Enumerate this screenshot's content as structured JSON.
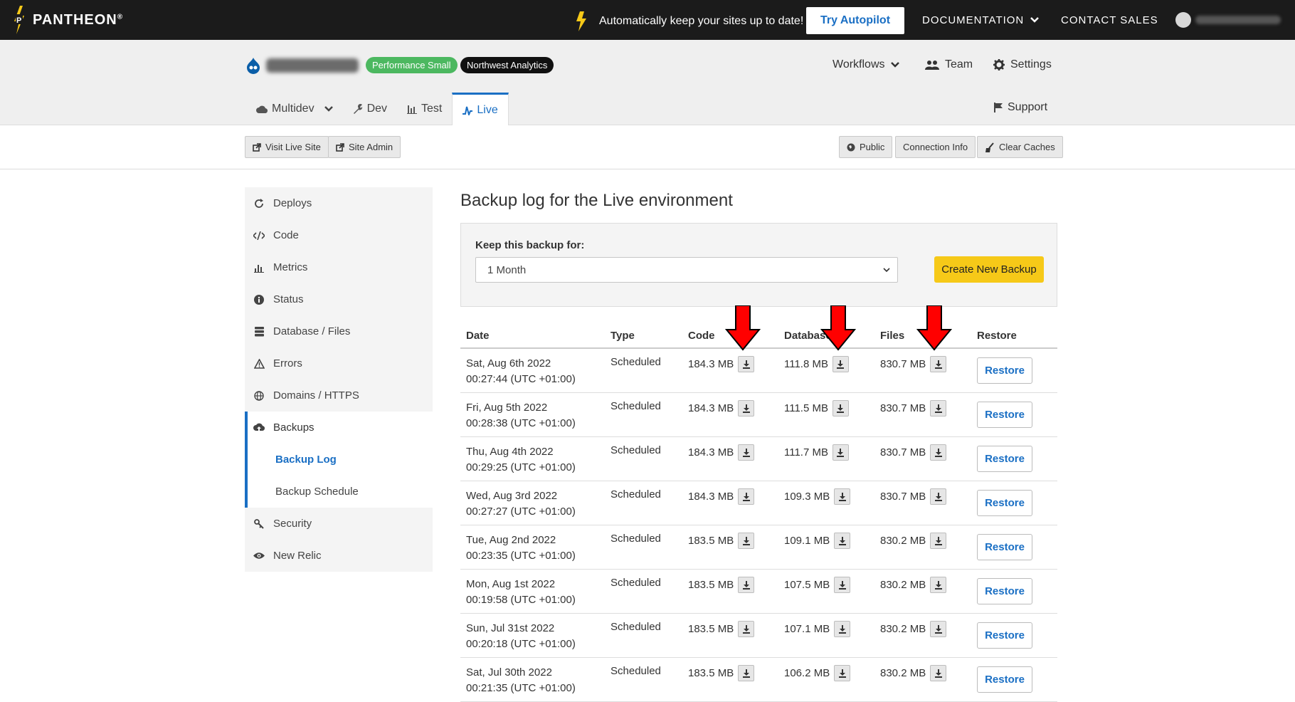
{
  "topbar": {
    "logo_text": "PANTHEON",
    "logo_reg": "®",
    "promo_text": "Automatically keep your sites up to date!",
    "try_button": "Try Autopilot",
    "documentation": "DOCUMENTATION",
    "contact_sales": "CONTACT SALES"
  },
  "site": {
    "badge_plan": "Performance Small",
    "badge_org": "Northwest Analytics",
    "workflows": "Workflows",
    "team": "Team",
    "settings": "Settings",
    "support": "Support"
  },
  "tabs": [
    {
      "label": "Multidev"
    },
    {
      "label": "Dev"
    },
    {
      "label": "Test"
    },
    {
      "label": "Live"
    }
  ],
  "toolbar": {
    "visit_live_site": "Visit Live Site",
    "site_admin": "Site Admin",
    "public": "Public",
    "connection_info": "Connection Info",
    "clear_caches": "Clear Caches"
  },
  "sidebar": {
    "items": [
      {
        "label": "Deploys",
        "icon": "refresh-icon"
      },
      {
        "label": "Code",
        "icon": "code-icon"
      },
      {
        "label": "Metrics",
        "icon": "bar-chart-icon"
      },
      {
        "label": "Status",
        "icon": "info-icon"
      },
      {
        "label": "Database / Files",
        "icon": "database-icon"
      },
      {
        "label": "Errors",
        "icon": "warning-icon"
      },
      {
        "label": "Domains / HTTPS",
        "icon": "globe-icon"
      },
      {
        "label": "Backups",
        "icon": "cloud-upload-icon"
      },
      {
        "label": "Backup Log"
      },
      {
        "label": "Backup Schedule"
      },
      {
        "label": "Security",
        "icon": "key-icon"
      },
      {
        "label": "New Relic",
        "icon": "eye-icon"
      }
    ]
  },
  "main": {
    "title": "Backup log for the Live environment",
    "keep_label": "Keep this backup for:",
    "keep_value": "1 Month",
    "create_button": "Create New Backup"
  },
  "table": {
    "headers": [
      "Date",
      "Type",
      "Code",
      "Database",
      "Files",
      "Restore"
    ],
    "rows": [
      {
        "date": "Sat, Aug 6th 2022",
        "time": "00:27:44 (UTC +01:00)",
        "type": "Scheduled",
        "code": "184.3 MB",
        "db": "111.8 MB",
        "files": "830.7 MB",
        "restore": "Restore"
      },
      {
        "date": "Fri, Aug 5th 2022",
        "time": "00:28:38 (UTC +01:00)",
        "type": "Scheduled",
        "code": "184.3 MB",
        "db": "111.5 MB",
        "files": "830.7 MB",
        "restore": "Restore"
      },
      {
        "date": "Thu, Aug 4th 2022",
        "time": "00:29:25 (UTC +01:00)",
        "type": "Scheduled",
        "code": "184.3 MB",
        "db": "111.7 MB",
        "files": "830.7 MB",
        "restore": "Restore"
      },
      {
        "date": "Wed, Aug 3rd 2022",
        "time": "00:27:27 (UTC +01:00)",
        "type": "Scheduled",
        "code": "184.3 MB",
        "db": "109.3 MB",
        "files": "830.7 MB",
        "restore": "Restore"
      },
      {
        "date": "Tue, Aug 2nd 2022",
        "time": "00:23:35 (UTC +01:00)",
        "type": "Scheduled",
        "code": "183.5 MB",
        "db": "109.1 MB",
        "files": "830.2 MB",
        "restore": "Restore"
      },
      {
        "date": "Mon, Aug 1st 2022",
        "time": "00:19:58 (UTC +01:00)",
        "type": "Scheduled",
        "code": "183.5 MB",
        "db": "107.5 MB",
        "files": "830.2 MB",
        "restore": "Restore"
      },
      {
        "date": "Sun, Jul 31st 2022",
        "time": "00:20:18 (UTC +01:00)",
        "type": "Scheduled",
        "code": "183.5 MB",
        "db": "107.1 MB",
        "files": "830.2 MB",
        "restore": "Restore"
      },
      {
        "date": "Sat, Jul 30th 2022",
        "time": "00:21:35 (UTC +01:00)",
        "type": "Scheduled",
        "code": "183.5 MB",
        "db": "106.2 MB",
        "files": "830.2 MB",
        "restore": "Restore"
      }
    ]
  },
  "colors": {
    "accent": "#1a6fc4",
    "topbar": "#1b1b1b",
    "create_button": "#f6c918",
    "annotation_arrow": "#ff0000"
  }
}
